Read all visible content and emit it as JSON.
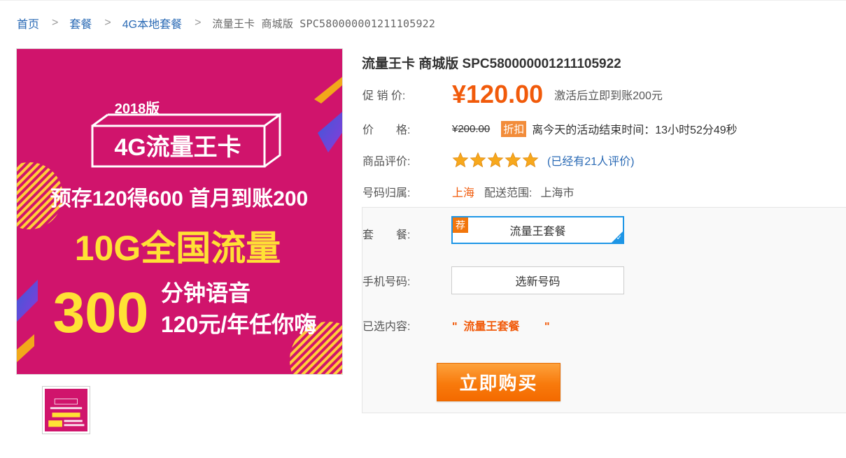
{
  "breadcrumb": {
    "items": [
      "首页",
      "套餐",
      "4G本地套餐"
    ],
    "current": "流量王卡 商城版 SPC580000001211105922"
  },
  "product": {
    "title": "流量王卡 商城版 SPC580000001211105922",
    "promo_label": "促 销 价:",
    "promo_price": "¥120.00",
    "promo_note": "激活后立即到账200元",
    "price_label": "价　　格:",
    "original_price": "¥200.00",
    "discount_badge": "折扣",
    "countdown": "离今天的活动结束时间：13小时52分49秒",
    "rating_label": "商品评价:",
    "rating": 5,
    "rating_max": 5,
    "review_text": "(已经有21人评价)",
    "location_label": "号码归属:",
    "location": "上海",
    "shipping_label": "配送范围:",
    "shipping_value": "上海市"
  },
  "options": {
    "package_label": "套　　餐:",
    "package_badge": "荐",
    "package_value": "流量王套餐",
    "phone_label": "手机号码:",
    "phone_button": "选新号码",
    "selected_label": "已选内容:",
    "selected_value": "\"  流量王套餐        \""
  },
  "buy_button": "立即购买",
  "banner": {
    "year": "2018版",
    "name": "4G流量王卡",
    "line1": "预存120得600 首月到账200",
    "line2": "10G全国流量",
    "big_number": "300",
    "line3a": "分钟语音",
    "line3b": "120元/年任你嗨"
  },
  "colors": {
    "link": "#2a6ab5",
    "price": "#f15a0a",
    "banner_bg": "#d0146c",
    "banner_yellow": "#ffe135",
    "selected_border": "#1e96e6"
  }
}
